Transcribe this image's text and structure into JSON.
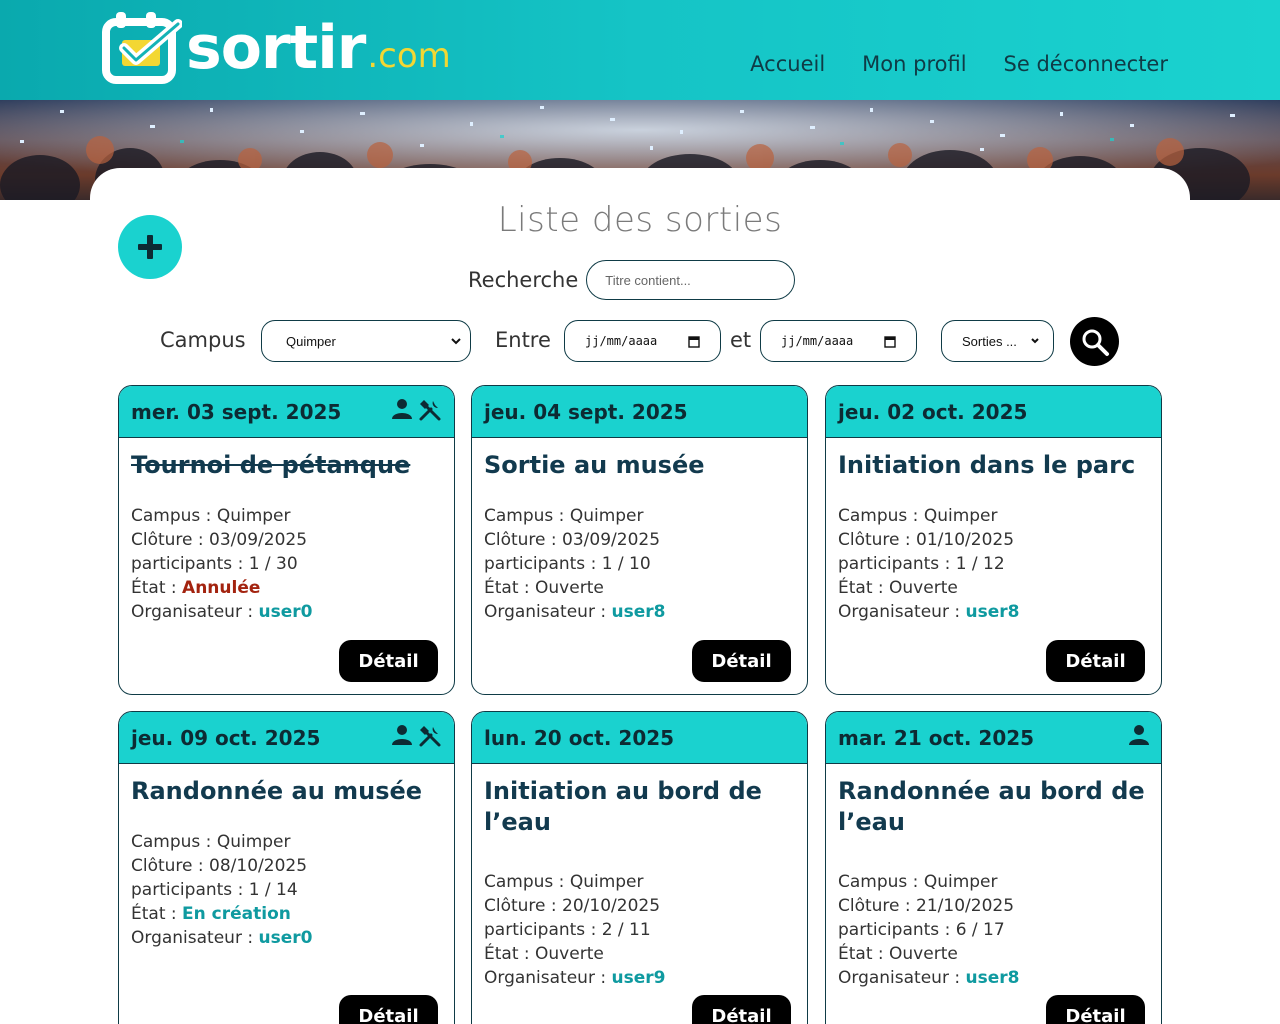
{
  "header": {
    "logo_text": "sortir",
    "logo_suffix": ".com",
    "nav": [
      "Accueil",
      "Mon profil",
      "Se déconnecter"
    ]
  },
  "page": {
    "title": "Liste des sorties",
    "search_label": "Recherche",
    "search_placeholder": "Titre contient...",
    "campus_label": "Campus",
    "campus_value": "Quimper",
    "between_label": "Entre",
    "and_label": "et",
    "date_placeholder": "jj/mm/aaaa",
    "sorties_value": "Sorties ..."
  },
  "labels": {
    "campus": "Campus : ",
    "cloture": "Clôture : ",
    "participants": "participants : ",
    "etat": "État : ",
    "organisateur": "Organisateur : ",
    "detail": "Détail"
  },
  "cards": [
    {
      "date": "mer. 03 sept. 2025",
      "title": "Tournoi de pétanque",
      "cancelled": true,
      "campus": "Quimper",
      "cloture": "03/09/2025",
      "participants": "1 / 30",
      "etat": "Annulée",
      "etat_style": "red",
      "organisateur": "user0",
      "icons": [
        "user-icon",
        "tools-icon"
      ]
    },
    {
      "date": "jeu. 04 sept. 2025",
      "title": "Sortie au musée",
      "cancelled": false,
      "campus": "Quimper",
      "cloture": "03/09/2025",
      "participants": "1 / 10",
      "etat": "Ouverte",
      "etat_style": "plain",
      "organisateur": "user8",
      "icons": []
    },
    {
      "date": "jeu. 02 oct. 2025",
      "title": "Initiation dans le parc",
      "cancelled": false,
      "campus": "Quimper",
      "cloture": "01/10/2025",
      "participants": "1 / 12",
      "etat": "Ouverte",
      "etat_style": "plain",
      "organisateur": "user8",
      "icons": []
    },
    {
      "date": "jeu. 09 oct. 2025",
      "title": "Randonnée au musée",
      "cancelled": false,
      "campus": "Quimper",
      "cloture": "08/10/2025",
      "participants": "1 / 14",
      "etat": "En création",
      "etat_style": "teal",
      "organisateur": "user0",
      "icons": [
        "user-icon",
        "tools-icon"
      ]
    },
    {
      "date": "lun. 20 oct. 2025",
      "title": "Initiation au bord de l’eau",
      "cancelled": false,
      "campus": "Quimper",
      "cloture": "20/10/2025",
      "participants": "2 / 11",
      "etat": "Ouverte",
      "etat_style": "plain",
      "organisateur": "user9",
      "icons": []
    },
    {
      "date": "mar. 21 oct. 2025",
      "title": "Randonnée au bord de l’eau",
      "cancelled": false,
      "campus": "Quimper",
      "cloture": "21/10/2025",
      "participants": "6 / 17",
      "etat": "Ouverte",
      "etat_style": "plain",
      "organisateur": "user8",
      "icons": [
        "user-icon"
      ]
    }
  ]
}
